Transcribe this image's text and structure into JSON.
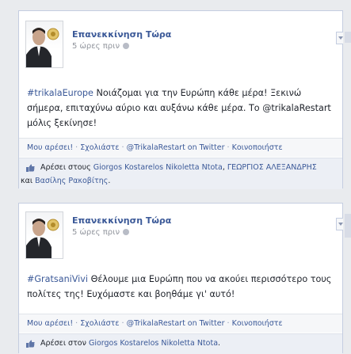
{
  "posts": [
    {
      "author": "Επανεκκίνηση Τώρα",
      "time": "5 ώρες πριν",
      "hashtag": "#trikalaEurope",
      "text": " Νοιάζομαι για την Ευρώπη κάθε μέρα! Ξεκινώ σήμερα, επιταχύνω αύριο και αυξάνω κάθε μέρα. Το @trikalaRestart μόλις ξεκίνησε!",
      "actions": {
        "like": "Μου αρέσει!",
        "comment": "Σχολιάστε",
        "twitter": "@TrikalaRestart on Twitter",
        "share": "Κοινοποιήστε"
      },
      "likes_prefix": "Αρέσει στους",
      "likers": [
        "Giorgos Kostarelos",
        "Nikoletta Ntota",
        "ΓΕΩΡΓΙΟΣ ΑΛΕΞΑΝΔΡΗΣ",
        "Βασίλης Ρακοβίτης"
      ],
      "and_word": "και",
      "likes_suffix": "."
    },
    {
      "author": "Επανεκκίνηση Τώρα",
      "time": "5 ώρες πριν",
      "hashtag": "#GratsaniVivi",
      "text": " Θέλουμε μια Ευρώπη που να ακούει περισσότερο τους πολίτες της! Ευχόμαστε και βοηθάμε γι' αυτό!",
      "actions": {
        "like": "Μου αρέσει!",
        "comment": "Σχολιάστε",
        "twitter": "@TrikalaRestart on Twitter",
        "share": "Κοινοποιήστε"
      },
      "likes_prefix": "Αρέσει στον",
      "likers": [
        "Giorgos Kostarelos",
        "Nikoletta Ntota"
      ],
      "likes_suffix": "."
    }
  ],
  "colors": {
    "link": "#3b5998",
    "background": "#e9ebee",
    "action_bar": "#f6f7f9",
    "likes_bar": "#eceff5"
  },
  "icons": {
    "like": "thumbs-up-icon",
    "time": "globe-icon",
    "menu": "chevron-down-icon"
  }
}
